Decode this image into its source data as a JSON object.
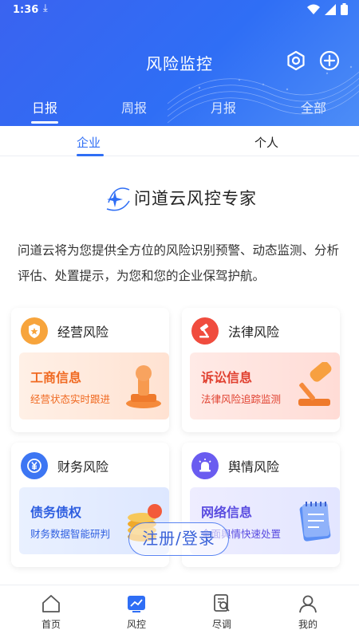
{
  "status": {
    "time": "1:36"
  },
  "header": {
    "title": "风险监控",
    "period_tabs": [
      "日报",
      "周报",
      "月报",
      "全部"
    ]
  },
  "sub_tabs": [
    "企业",
    "个人"
  ],
  "expert": {
    "title": "问道云风控专家"
  },
  "intro": "问道云将为您提供全方位的风险识别预警、动态监测、分析评估、处置提示，为您和您的企业保驾护航。",
  "risk_cards": [
    {
      "title": "经营风险",
      "inner_title": "工商信息",
      "inner_sub": "经营状态实时跟进"
    },
    {
      "title": "法律风险",
      "inner_title": "诉讼信息",
      "inner_sub": "法律风险追踪监测"
    },
    {
      "title": "财务风险",
      "inner_title": "债务债权",
      "inner_sub": "财务数据智能研判"
    },
    {
      "title": "舆情风险",
      "inner_title": "网络信息",
      "inner_sub": "全面舆情快速处置"
    }
  ],
  "register_button": "注册/登录",
  "bottom_nav": [
    "首页",
    "风控",
    "尽调",
    "我的"
  ],
  "colors": {
    "primary": "#2f6ef5",
    "orange": "#f7a43c",
    "red": "#f04c3e",
    "blue": "#3d76f3",
    "purple": "#6a5cf0"
  }
}
